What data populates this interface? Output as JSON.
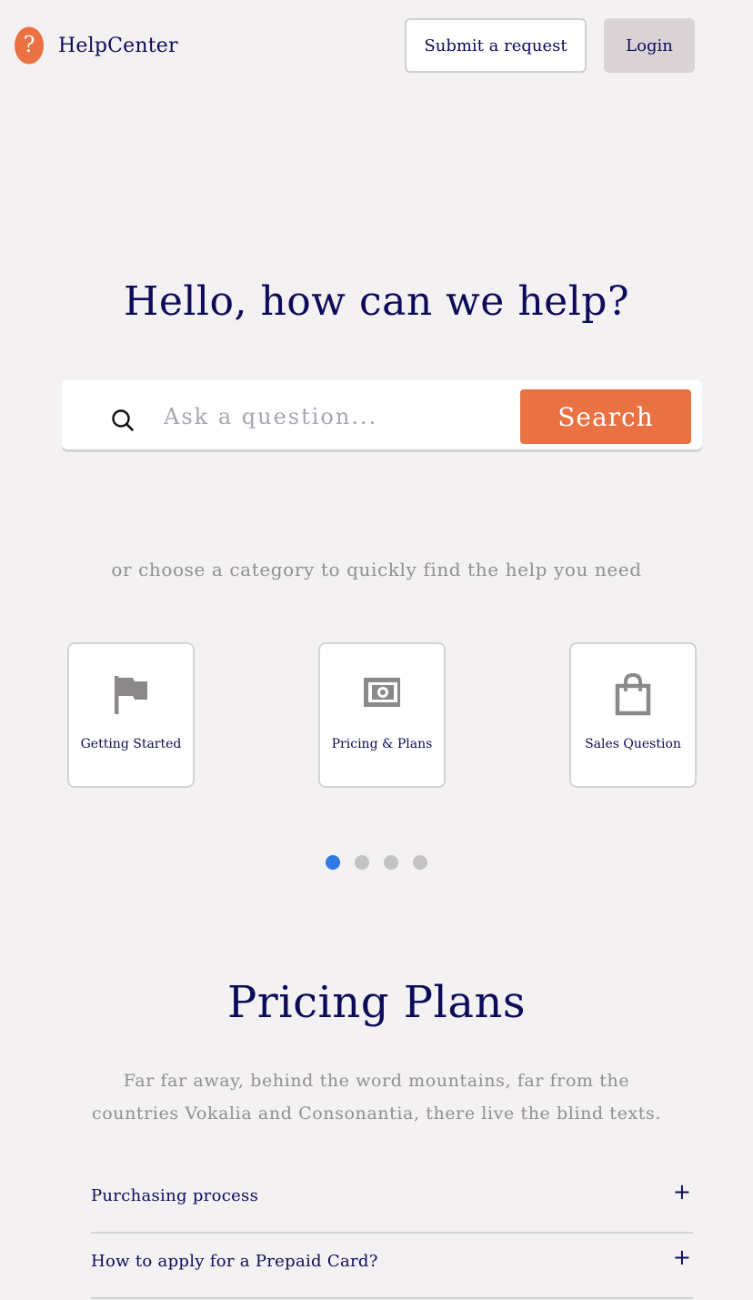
{
  "header": {
    "brand": "HelpCenter",
    "logo_icon": "question-icon",
    "submit_label": "Submit a request",
    "login_label": "Login"
  },
  "hero": {
    "title": "Hello, how can we help?",
    "search_placeholder": "Ask a question...",
    "search_value": "",
    "search_button": "Search",
    "subtitle": "or choose a category to quickly find the help you need"
  },
  "categories": [
    {
      "label": "Getting Started",
      "icon": "flag-icon"
    },
    {
      "label": "Pricing & Plans",
      "icon": "money-icon"
    },
    {
      "label": "Sales Question",
      "icon": "shopping-bag-icon"
    }
  ],
  "carousel": {
    "dot_count": 4,
    "active_index": 0
  },
  "pricing": {
    "title": "Pricing Plans",
    "description": "Far far away, behind the word mountains, far from the countries Vokalia and Consonantia, there live the blind texts.",
    "faqs": [
      {
        "question": "Purchasing process",
        "toggle": "+"
      },
      {
        "question": "How to apply for a Prepaid Card?",
        "toggle": "+"
      }
    ]
  },
  "colors": {
    "accent": "#e97142",
    "navy": "#0b0b5a",
    "background": "#f3f1f2",
    "dot_active": "#2f7ae5",
    "dot_inactive": "#c3c3c3"
  }
}
